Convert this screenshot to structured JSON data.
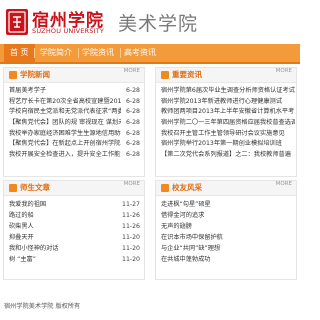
{
  "header": {
    "logo_cn": "宿州学院",
    "logo_en": "SUZHOU UNIVERSITY",
    "site_title": "美术学院"
  },
  "nav": {
    "items": [
      "首 页",
      "学院简介",
      "学院资讯",
      "高考资讯"
    ]
  },
  "panels": {
    "college_news": {
      "title": "学院新闻",
      "more": "MORE",
      "items": [
        {
          "title": "首届美考学子",
          "date": "6-28"
        },
        {
          "title": "程艺厅长卡在第20次全省高校宣建暨2013年度高教",
          "date": "6-28"
        },
        {
          "title": "学校向宿民主党派和无党派代表征求“两委”工作",
          "date": "6-28"
        },
        {
          "title": "【聚焦党代会】团队的规 审视现在 谋划未来",
          "date": "6-28"
        },
        {
          "title": "我校举办家庭经济困难学生生源地信用助学贷款专",
          "date": "6-28"
        },
        {
          "title": "【聚焦党代会】在新起点上开创宿州学院发展新局",
          "date": "6-28"
        },
        {
          "title": "我校开展安全检查进入，提升安全工作能力",
          "date": "6-28"
        }
      ]
    },
    "notices": {
      "title": "重要资讯",
      "more": "MORE",
      "items": [
        {
          "title": "宿州学院第6届次毕业生调查分析师资格认证考试"
        },
        {
          "title": "宿州学院2013年新进教师进行心理健康测试"
        },
        {
          "title": "教师团两项目2013年上半年安徽省计算机水平考"
        },
        {
          "title": "宿州学院二〇一三年第四届资格应届我校普查选调"
        },
        {
          "title": "我校召开主管工作主管领导研讨会议实施意见"
        },
        {
          "title": "宿州学院举行2013年第一期创业模拟培训班"
        },
        {
          "title": "【第二次党代会系列报道】之二：我校教师普遍"
        }
      ]
    },
    "teacher_articles": {
      "title": "师生文章",
      "more": "MORE",
      "items": [
        {
          "title": "我爱我的祖国",
          "date": "11-27"
        },
        {
          "title": "路过的船",
          "date": "11-26"
        },
        {
          "title": "砍柴黑人",
          "date": "11-26"
        },
        {
          "title": "抑叠天开",
          "date": "11-20"
        },
        {
          "title": "我和小怪神的对话",
          "date": "11-20"
        },
        {
          "title": "树 “主富”",
          "date": "11-20"
        }
      ]
    },
    "expo": {
      "title": "校友风采",
      "more": "MORE",
      "items": [
        {
          "title": "走进枫“勾星”硕星"
        },
        {
          "title": "借得金河的追求"
        },
        {
          "title": "无声的翅膀"
        },
        {
          "title": "在识本市场中保留护航"
        },
        {
          "title": "与企业“共同”缺”理想"
        },
        {
          "title": "在共城中蓬勃成功"
        }
      ]
    }
  },
  "footer": {
    "text": "宿州学院美术学院  版权所有"
  },
  "colors": {
    "brand_red": "#c8141c",
    "nav_orange": "#f39a3a",
    "nav_active": "#e8781c",
    "panel_title": "#e06c12"
  }
}
